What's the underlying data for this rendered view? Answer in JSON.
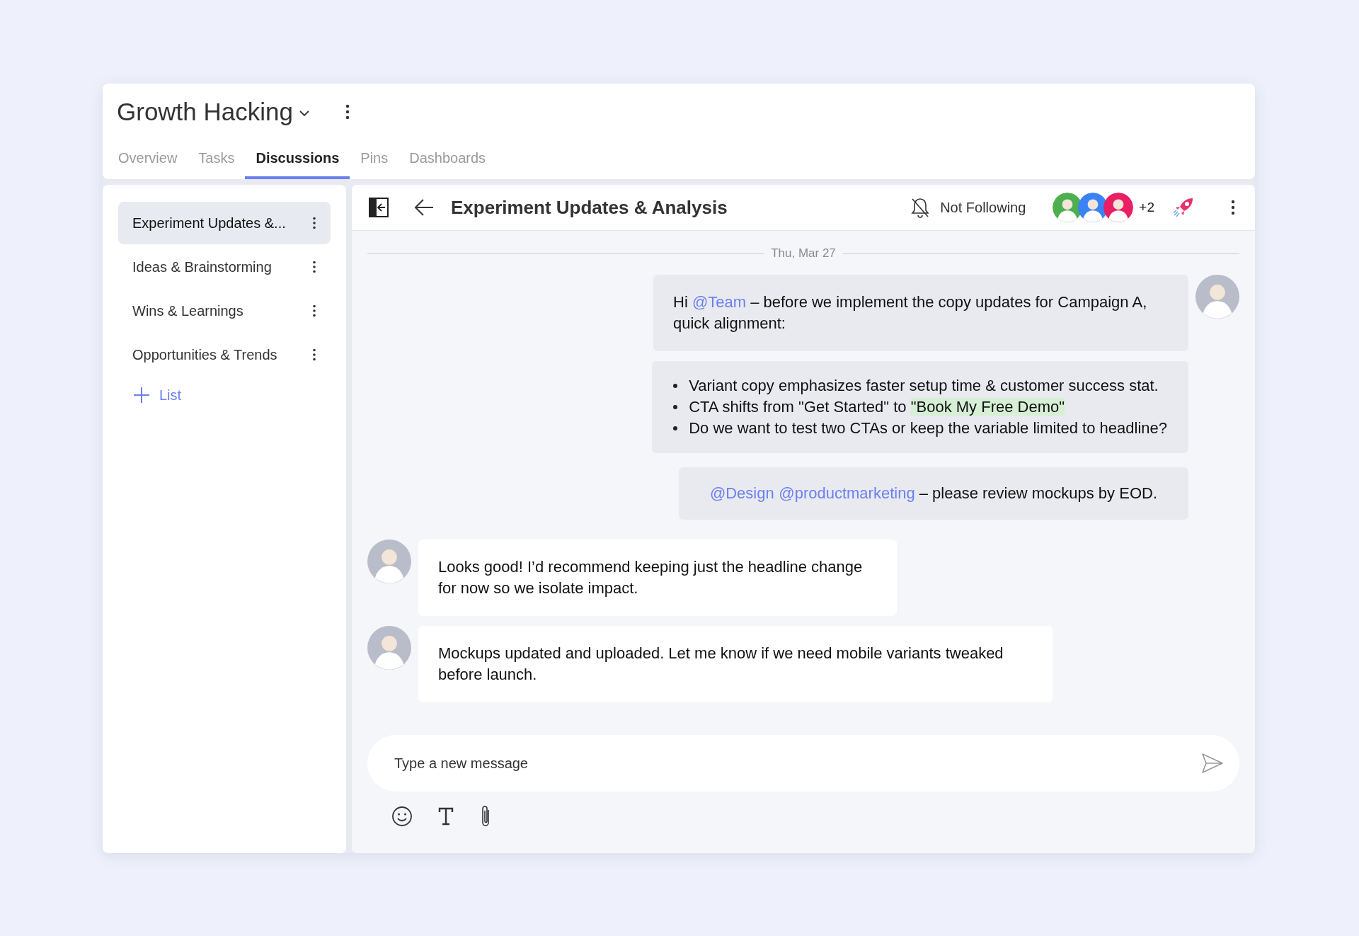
{
  "project": {
    "title": "Growth Hacking"
  },
  "tabs": [
    {
      "label": "Overview",
      "selected": false
    },
    {
      "label": "Tasks",
      "selected": false
    },
    {
      "label": "Discussions",
      "selected": true
    },
    {
      "label": "Pins",
      "selected": false
    },
    {
      "label": "Dashboards",
      "selected": false
    }
  ],
  "sidebar": {
    "items": [
      {
        "label": "Experiment Updates &...",
        "selected": true
      },
      {
        "label": "Ideas & Brainstorming",
        "selected": false
      },
      {
        "label": "Wins & Learnings",
        "selected": false
      },
      {
        "label": "Opportunities & Trends",
        "selected": false
      }
    ],
    "add_label": "List"
  },
  "discussion": {
    "title": "Experiment Updates & Analysis",
    "follow_label": "Not Following",
    "following": false,
    "members": [
      {
        "color": "#4caf50"
      },
      {
        "color": "#3b82f6"
      },
      {
        "color": "#e91e63"
      }
    ],
    "extra_members": "+2"
  },
  "date_divider": "Thu, Mar 27",
  "messages": [
    {
      "kind": "outgoing",
      "avatar": true,
      "paragraphs": [
        [
          {
            "kind": "plain",
            "text": "Hi "
          },
          {
            "kind": "mention",
            "text": "@Team"
          },
          {
            "kind": "plain",
            "text": " – before we implement the copy updates for Campaign A, quick alignment:"
          }
        ]
      ]
    },
    {
      "kind": "outgoing",
      "bullets": [
        [
          {
            "kind": "plain",
            "text": "Variant copy emphasizes faster setup time & customer success stat."
          }
        ],
        [
          {
            "kind": "plain",
            "text": "CTA shifts from \"Get Started\" to "
          },
          {
            "kind": "highlight",
            "text": "\"Book My Free Demo\""
          }
        ],
        [
          {
            "kind": "plain",
            "text": "Do we want to test two CTAs or keep the variable limited to headline?"
          }
        ]
      ]
    },
    {
      "kind": "outgoing",
      "paragraphs": [
        [
          {
            "kind": "mention",
            "text": "@Design"
          },
          {
            "kind": "mention",
            "text": "@productmarketing"
          },
          {
            "kind": "plain",
            "text": " – please review mockups by EOD."
          }
        ]
      ]
    },
    {
      "kind": "incoming",
      "avatar": true,
      "paragraphs": [
        [
          {
            "kind": "plain",
            "text": "Looks good! I’d recommend keeping just the headline change for now so we isolate impact."
          }
        ]
      ]
    },
    {
      "kind": "incoming",
      "avatar": true,
      "paragraphs": [
        [
          {
            "kind": "plain",
            "text": "Mockups updated and uploaded. Let me know if we need mobile variants tweaked before launch."
          }
        ]
      ]
    }
  ],
  "composer": {
    "placeholder": "Type a new message"
  }
}
